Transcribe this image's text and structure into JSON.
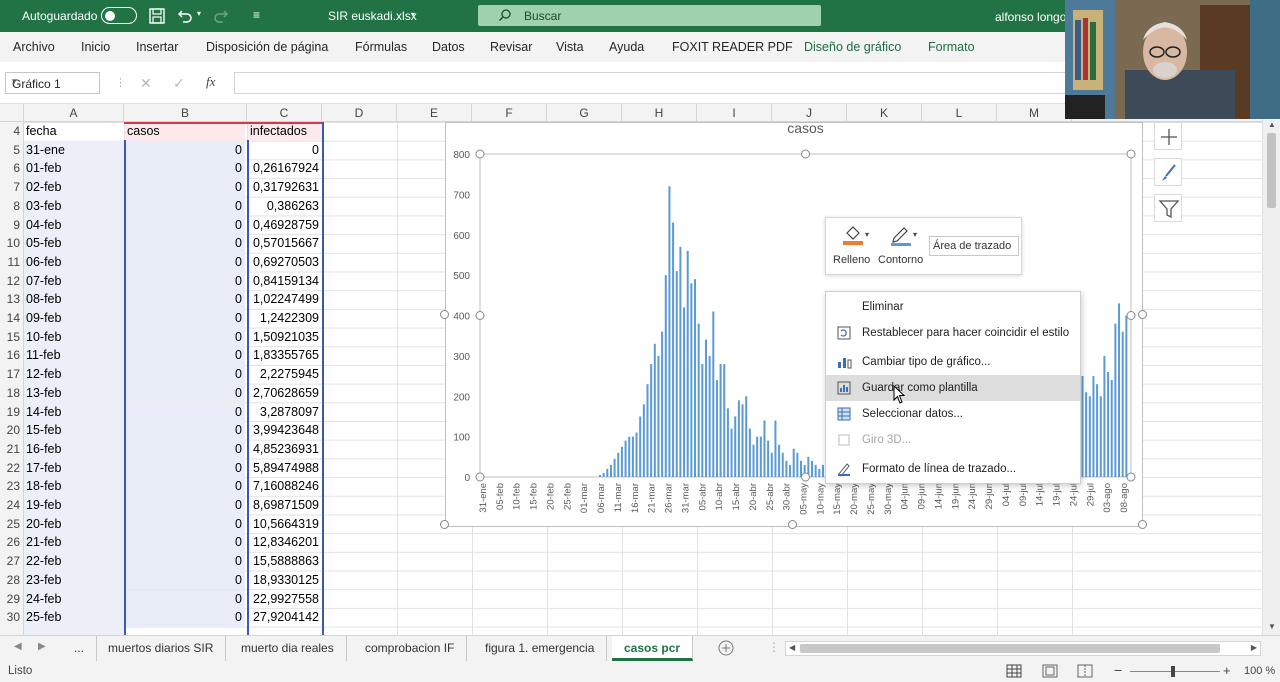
{
  "titlebar": {
    "autosave_label": "Autoguardado",
    "file_title": "SIR euskadi.xlsx",
    "search_label": "Buscar",
    "user_name": "alfonso longo"
  },
  "menubar": {
    "tabs": [
      "Archivo",
      "Inicio",
      "Insertar",
      "Disposición de página",
      "Fórmulas",
      "Datos",
      "Revisar",
      "Vista",
      "Ayuda",
      "FOXIT READER PDF",
      "Diseño de gráfico",
      "Formato"
    ]
  },
  "formula": {
    "name_box": "Gráfico 1",
    "fx_label": "fx",
    "value": ""
  },
  "columns": [
    "A",
    "B",
    "C",
    "D",
    "E",
    "F",
    "G",
    "H",
    "I",
    "J",
    "K",
    "L",
    "M"
  ],
  "sheet": {
    "header": {
      "row": "4",
      "a": "fecha",
      "b": "casos",
      "c": "infectados"
    },
    "rows": [
      {
        "n": "5",
        "a": "31-ene",
        "b": "0",
        "c": "0"
      },
      {
        "n": "6",
        "a": "01-feb",
        "b": "0",
        "c": "0,26167924"
      },
      {
        "n": "7",
        "a": "02-feb",
        "b": "0",
        "c": "0,31792631"
      },
      {
        "n": "8",
        "a": "03-feb",
        "b": "0",
        "c": "0,386263"
      },
      {
        "n": "9",
        "a": "04-feb",
        "b": "0",
        "c": "0,46928759"
      },
      {
        "n": "10",
        "a": "05-feb",
        "b": "0",
        "c": "0,57015667"
      },
      {
        "n": "11",
        "a": "06-feb",
        "b": "0",
        "c": "0,69270503"
      },
      {
        "n": "12",
        "a": "07-feb",
        "b": "0",
        "c": "0,84159134"
      },
      {
        "n": "13",
        "a": "08-feb",
        "b": "0",
        "c": "1,02247499"
      },
      {
        "n": "14",
        "a": "09-feb",
        "b": "0",
        "c": "1,2422309"
      },
      {
        "n": "15",
        "a": "10-feb",
        "b": "0",
        "c": "1,50921035"
      },
      {
        "n": "16",
        "a": "11-feb",
        "b": "0",
        "c": "1,83355765"
      },
      {
        "n": "17",
        "a": "12-feb",
        "b": "0",
        "c": "2,2275945"
      },
      {
        "n": "18",
        "a": "13-feb",
        "b": "0",
        "c": "2,70628659"
      },
      {
        "n": "19",
        "a": "14-feb",
        "b": "0",
        "c": "3,2878097"
      },
      {
        "n": "20",
        "a": "15-feb",
        "b": "0",
        "c": "3,99423648"
      },
      {
        "n": "21",
        "a": "16-feb",
        "b": "0",
        "c": "4,85236931"
      },
      {
        "n": "22",
        "a": "17-feb",
        "b": "0",
        "c": "5,89474988"
      },
      {
        "n": "23",
        "a": "18-feb",
        "b": "0",
        "c": "7,16088246"
      },
      {
        "n": "24",
        "a": "19-feb",
        "b": "0",
        "c": "8,69871509"
      },
      {
        "n": "25",
        "a": "20-feb",
        "b": "0",
        "c": "10,5664319"
      },
      {
        "n": "26",
        "a": "21-feb",
        "b": "0",
        "c": "12,8346201"
      },
      {
        "n": "27",
        "a": "22-feb",
        "b": "0",
        "c": "15,5888863"
      },
      {
        "n": "28",
        "a": "23-feb",
        "b": "0",
        "c": "18,9330125"
      },
      {
        "n": "29",
        "a": "24-feb",
        "b": "0",
        "c": "22,9927558"
      },
      {
        "n": "30",
        "a": "25-feb",
        "b": "0",
        "c": "27,9204142"
      }
    ]
  },
  "chart_data": {
    "type": "bar",
    "title": "casos",
    "ylim": [
      0,
      800
    ],
    "yticks": [
      0,
      100,
      200,
      300,
      400,
      500,
      600,
      700,
      800
    ],
    "xtick_labels": [
      "31-ene",
      "05-feb",
      "10-feb",
      "15-feb",
      "20-feb",
      "25-feb",
      "01-mar",
      "06-mar",
      "11-mar",
      "16-mar",
      "21-mar",
      "26-mar",
      "31-mar",
      "05-abr",
      "10-abr",
      "15-abr",
      "20-abr",
      "25-abr",
      "30-abr",
      "05-may",
      "10-may",
      "15-may",
      "20-may",
      "25-may",
      "30-may",
      "04-jun",
      "09-jun",
      "14-jun",
      "19-jun",
      "24-jun",
      "29-jun",
      "04-jul",
      "09-jul",
      "14-jul",
      "19-jul",
      "24-jul",
      "29-jul",
      "03-ago",
      "08-ago"
    ],
    "values": [
      0,
      0,
      0,
      0,
      0,
      0,
      0,
      0,
      0,
      0,
      0,
      0,
      0,
      0,
      0,
      0,
      0,
      0,
      0,
      0,
      0,
      0,
      0,
      0,
      0,
      0,
      0,
      0,
      0,
      0,
      0,
      0,
      5,
      10,
      20,
      30,
      45,
      60,
      75,
      90,
      100,
      100,
      110,
      150,
      180,
      230,
      280,
      330,
      300,
      360,
      500,
      720,
      630,
      510,
      570,
      420,
      560,
      480,
      490,
      380,
      280,
      340,
      300,
      410,
      240,
      280,
      280,
      170,
      120,
      150,
      190,
      180,
      200,
      120,
      80,
      100,
      100,
      140,
      90,
      60,
      140,
      80,
      60,
      40,
      30,
      70,
      60,
      40,
      30,
      50,
      40,
      30,
      20,
      30,
      40,
      20,
      10,
      20,
      10,
      15,
      10,
      5,
      10,
      8,
      10,
      12,
      8,
      10,
      6,
      8,
      5,
      6,
      4,
      5,
      3,
      4,
      3,
      5,
      6,
      4,
      3,
      2,
      3,
      4,
      5,
      3,
      4,
      3,
      5,
      6,
      5,
      8,
      10,
      12,
      15,
      10,
      8,
      12,
      10,
      15,
      20,
      25,
      30,
      40,
      50,
      60,
      80,
      100,
      120,
      140,
      150,
      170,
      140,
      160,
      130,
      180,
      200,
      170,
      180,
      200,
      220,
      180,
      150,
      200,
      250,
      210,
      200,
      250,
      230,
      200,
      300,
      260,
      240,
      380,
      430,
      360,
      400
    ],
    "grid": false,
    "legend": "none",
    "bar_color": "#5b9bd5"
  },
  "minibar": {
    "fill_label": "Relleno",
    "outline_label": "Contorno",
    "element_select": "Área de trazado"
  },
  "context_menu": {
    "items": [
      {
        "label": "Eliminar",
        "icon": "none"
      },
      {
        "label": "Restablecer para hacer coincidir el estilo",
        "icon": "reset-style-icon"
      },
      {
        "label": "Cambiar tipo de gráfico...",
        "icon": "chart-type-icon"
      },
      {
        "label": "Guardar como plantilla",
        "icon": "save-template-icon"
      },
      {
        "label": "Seleccionar datos...",
        "icon": "select-data-icon"
      },
      {
        "label": "Giro 3D...",
        "icon": "rotation-3d-icon"
      },
      {
        "label": "Formato de línea de trazado...",
        "icon": "format-line-icon"
      }
    ]
  },
  "sheet_tabs": {
    "more": "...",
    "tabs": [
      "muertos diarios SIR",
      "muerto dia reales",
      "comprobacion IF",
      "figura 1. emergencia",
      "casos pcr"
    ],
    "active": "casos pcr"
  },
  "statusbar": {
    "ready": "Listo",
    "zoom": "100 %"
  },
  "colors": {
    "excel_green": "#217346",
    "bar_blue": "#5b9bd5",
    "fill_orange": "#ed7d31",
    "outline_blue": "#5b9bd5"
  }
}
